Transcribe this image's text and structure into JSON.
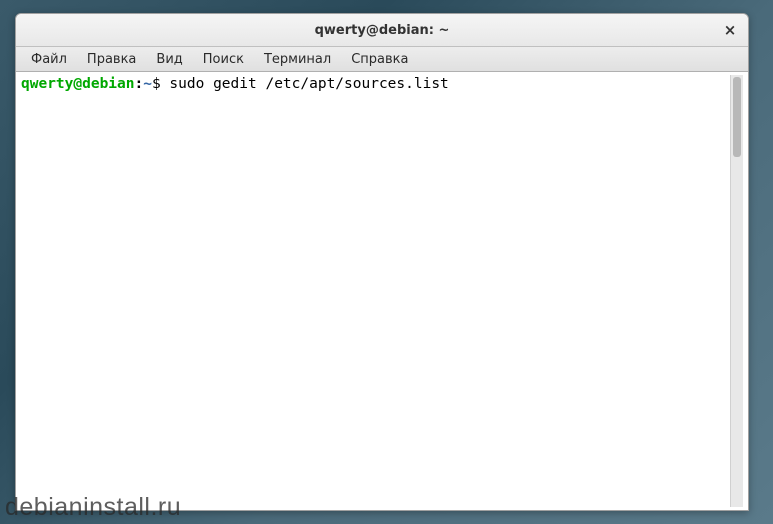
{
  "window": {
    "title": "qwerty@debian: ~",
    "close_symbol": "×"
  },
  "menubar": {
    "items": [
      {
        "label": "Файл"
      },
      {
        "label": "Правка"
      },
      {
        "label": "Вид"
      },
      {
        "label": "Поиск"
      },
      {
        "label": "Терминал"
      },
      {
        "label": "Справка"
      }
    ]
  },
  "terminal": {
    "prompt": {
      "user_host": "qwerty@debian",
      "separator": ":",
      "path": "~",
      "symbol": "$"
    },
    "command": " sudo gedit /etc/apt/sources.list"
  },
  "watermark": "debianinstall.ru"
}
